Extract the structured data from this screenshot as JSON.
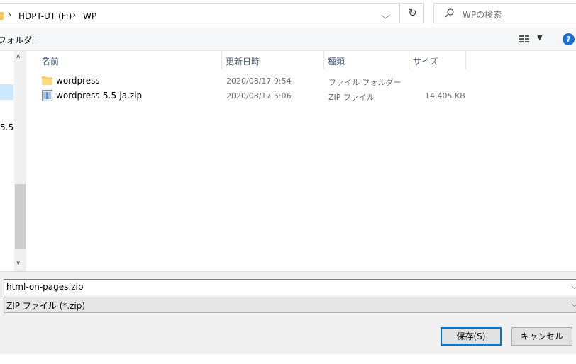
{
  "address": {
    "crumbs": [
      "HDPT-UT (F:)",
      "WP"
    ],
    "separator": "›",
    "refresh_glyph": "↻",
    "dropdown_glyph": "⌵"
  },
  "search": {
    "placeholder": "WPの検索"
  },
  "toolbar": {
    "new_folder_label": "フォルダー",
    "help_label": "?",
    "view_dropdown_glyph": "▼"
  },
  "nav": {
    "partial_text": "5.5-",
    "scroll_up_glyph": "∧",
    "scroll_down_glyph": "∨"
  },
  "columns": {
    "name": "名前",
    "modified": "更新日時",
    "type": "種類",
    "size": "サイズ",
    "sort_glyph": "^"
  },
  "files": [
    {
      "icon": "folder-icon",
      "name": "wordpress",
      "modified": "2020/08/17 9:54",
      "type": "ファイル フォルダー",
      "size": ""
    },
    {
      "icon": "zip-icon",
      "name": "wordpress-5.5-ja.zip",
      "modified": "2020/08/17 5:06",
      "type": "ZIP ファイル",
      "size": "14,405 KB"
    }
  ],
  "filename_field": {
    "value": "html-on-pages.zip"
  },
  "filetype_field": {
    "value": "ZIP ファイル (*.zip)"
  },
  "field_dropdown_glyph": "⌵",
  "buttons": {
    "save": "保存(S)",
    "cancel": "キャンセル"
  },
  "colors": {
    "accent": "#0078d7",
    "selection": "#cce8ff",
    "folder": "#f6c75a",
    "help": "#1e6fd2"
  }
}
